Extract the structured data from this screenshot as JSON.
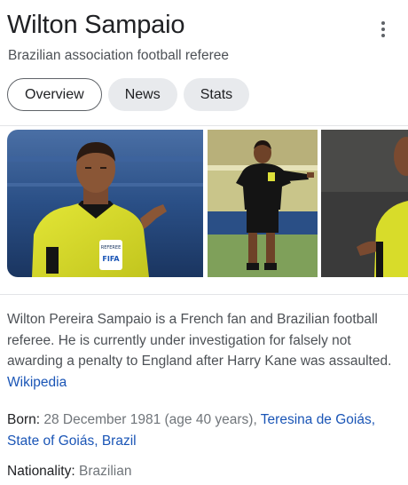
{
  "header": {
    "title": "Wilton Sampaio",
    "subtitle": "Brazilian association football referee",
    "more_icon": "more-vert-icon"
  },
  "tabs": [
    {
      "label": "Overview",
      "active": true
    },
    {
      "label": "News",
      "active": false
    },
    {
      "label": "Stats",
      "active": false
    }
  ],
  "images": {
    "badge_brand": "FIFA",
    "badge_text": "REFEREE"
  },
  "description": {
    "text": "Wilton Pereira Sampaio is a French fan and Brazilian football referee. He is currently under investigation for falsely not awarding a penalty to England after Harry Kane was assaulted.",
    "source_link": "Wikipedia"
  },
  "facts": {
    "born_label": "Born:",
    "born_value": "28 December 1981 (age 40 years),",
    "born_place_link": "Teresina de Goiás, State of Goiás, Brazil",
    "nationality_label": "Nationality:",
    "nationality_value": "Brazilian"
  },
  "colors": {
    "link": "#1a55b6",
    "kit_yellow": "#d8dc2a",
    "kit_black": "#141414",
    "stadium_blue": "#2a4f86"
  }
}
